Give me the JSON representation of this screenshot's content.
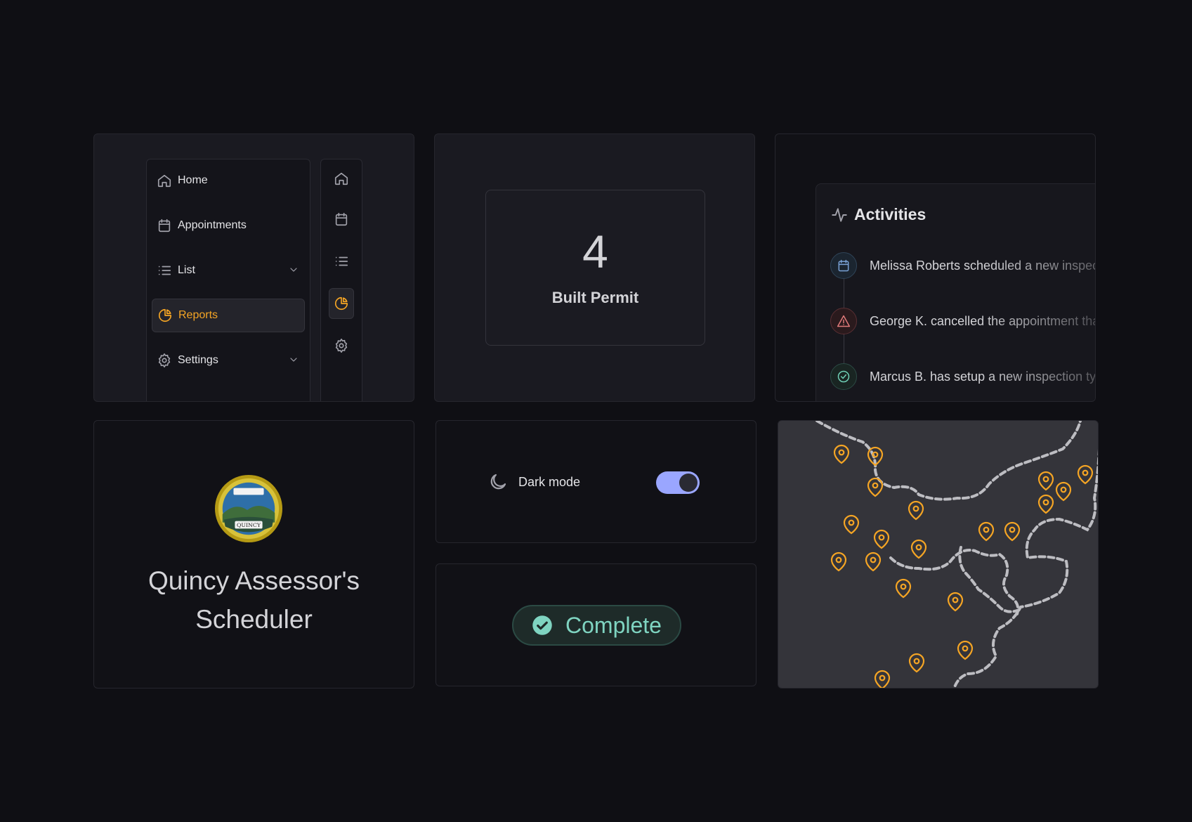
{
  "sidebar": {
    "items": [
      {
        "label": "Home",
        "icon": "home-icon"
      },
      {
        "label": "Appointments",
        "icon": "calendar-icon"
      },
      {
        "label": "List",
        "icon": "list-icon"
      },
      {
        "label": "Reports",
        "icon": "pie-chart-icon",
        "active": true
      },
      {
        "label": "Settings",
        "icon": "gear-icon"
      }
    ]
  },
  "stat": {
    "value": "4",
    "label": "Built Permit"
  },
  "activities": {
    "title": "Activities",
    "items": [
      {
        "text": "Melissa Roberts scheduled a new inspection",
        "icon": "calendar-icon",
        "color": "#7aa2d6"
      },
      {
        "text": "George K. cancelled the appointment that",
        "icon": "warning-icon",
        "color": "#e07a7a"
      },
      {
        "text": "Marcus B. has setup a new inspection type",
        "icon": "check-circle-icon",
        "color": "#6fcfb5"
      }
    ]
  },
  "brand": {
    "title_line1": "Quincy Assessor's",
    "title_line2": "Scheduler",
    "seal_text": "QUINCY"
  },
  "darkmode": {
    "label": "Dark mode",
    "enabled": true
  },
  "status": {
    "label": "Complete",
    "color": "#7fd4c1"
  },
  "colors": {
    "accent": "#f5a524",
    "toggle": "#9aa6ff",
    "background": "#0f0f14"
  }
}
